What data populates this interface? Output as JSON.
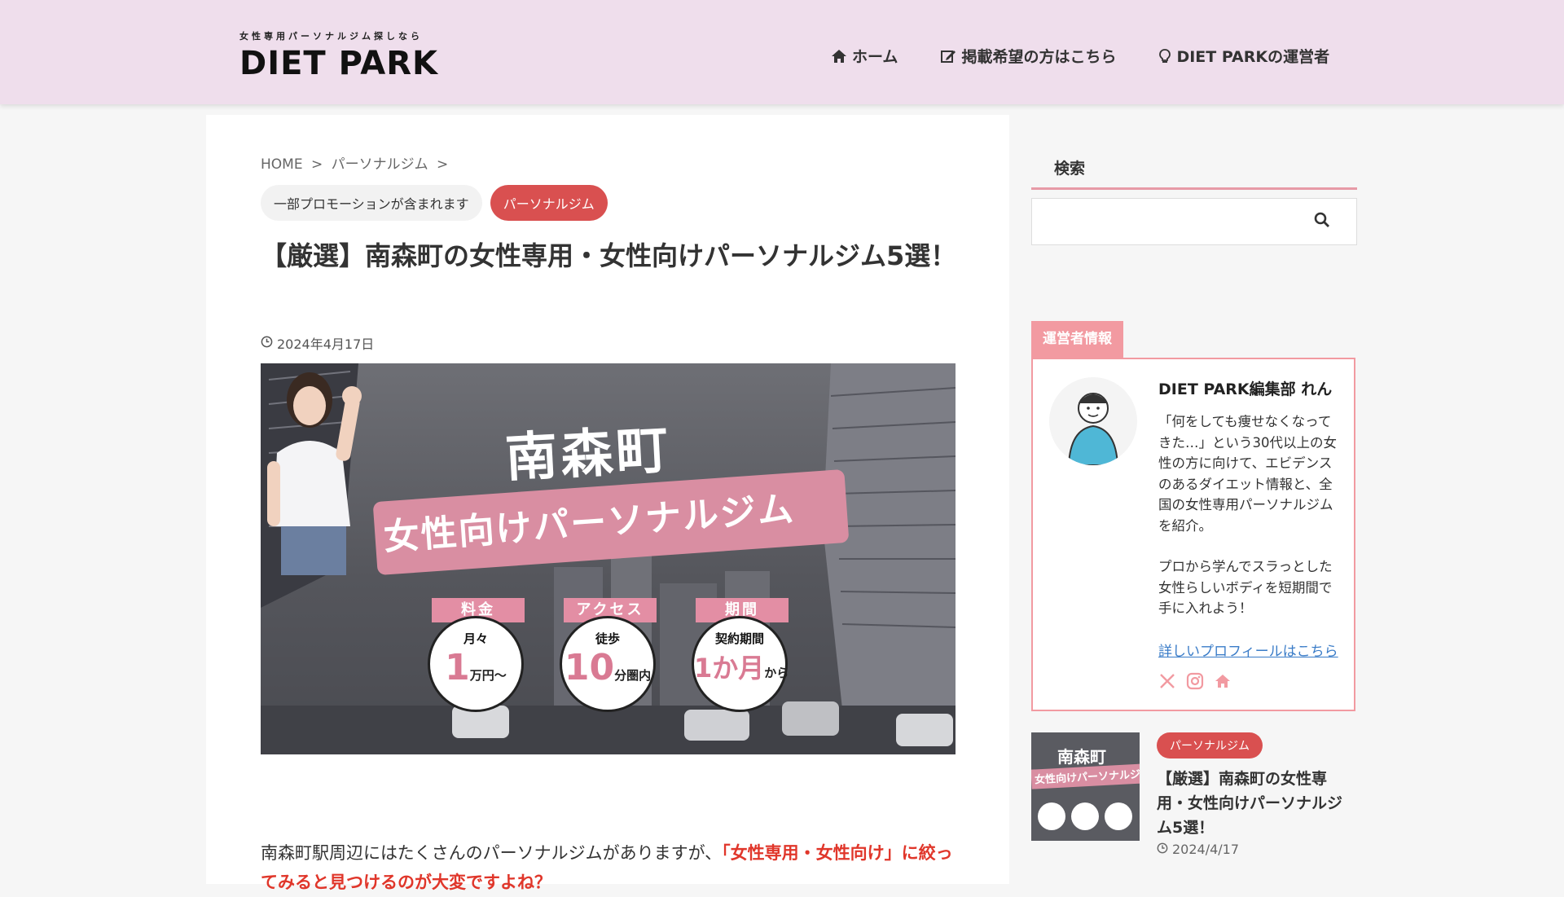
{
  "header": {
    "logo_tagline": "女性専用パーソナルジム探しなら",
    "logo_text": "DIET PARK",
    "nav": [
      {
        "label": "ホーム",
        "icon": "home-icon"
      },
      {
        "label": "掲載希望の方はこちら",
        "icon": "edit-icon"
      },
      {
        "label": "DIET PARKの運営者",
        "icon": "lightbulb-icon"
      }
    ]
  },
  "article": {
    "breadcrumb": [
      "HOME",
      "パーソナルジム"
    ],
    "breadcrumb_sep": ">",
    "promo_tag": "一部プロモーションが含まれます",
    "category_tag": "パーソナルジム",
    "title": "【厳選】南森町の女性専用・女性向けパーソナルジム5選！",
    "date": "2024年4月17日",
    "hero": {
      "title_top": "南森町",
      "title_band": "女性向けパーソナルジム",
      "badges": [
        {
          "label": "料金",
          "sub": "月々",
          "value": "1",
          "suffix": "万円〜"
        },
        {
          "label": "アクセス",
          "sub": "徒歩",
          "value": "10",
          "suffix": "分圏内"
        },
        {
          "label": "期間",
          "sub": "契約期間",
          "value": "1か月",
          "suffix": "から"
        }
      ]
    },
    "body_text_start": "南森町駅周辺にはたくさんのパーソナルジムがありますが、",
    "body_text_red": "「女性専用・女性向け」",
    "body_text_next": "に絞ってみると見つけるのが大変ですよね？"
  },
  "sidebar": {
    "search_title": "検索",
    "search_placeholder": "",
    "profile": {
      "tab": "運営者情報",
      "name": "DIET PARK編集部 れん",
      "desc1": "「何をしても痩せなくなってきた…」という30代以上の女性の方に向けて、エビデンスのあるダイエット情報と、全国の女性専用パーソナルジムを紹介。",
      "desc2": "プロから学んでスラっとした女性らしいボディを短期間で手に入れよう！",
      "link": "詳しいプロフィールはこちら",
      "social": [
        "x-icon",
        "instagram-icon",
        "home-icon"
      ]
    },
    "related": {
      "thumb_title": "南森町",
      "thumb_sub": "女性向けパーソナルジ",
      "category": "パーソナルジム",
      "title": "【厳選】南森町の女性専用・女性向けパーソナルジム5選！",
      "date": "2024/4/17"
    }
  },
  "colors": {
    "header_bg": "#efdeec",
    "category_red": "#d95050",
    "pink_accent": "#f29aa1",
    "link_blue": "#3a7cc8",
    "highlight_red": "#e0362a"
  }
}
